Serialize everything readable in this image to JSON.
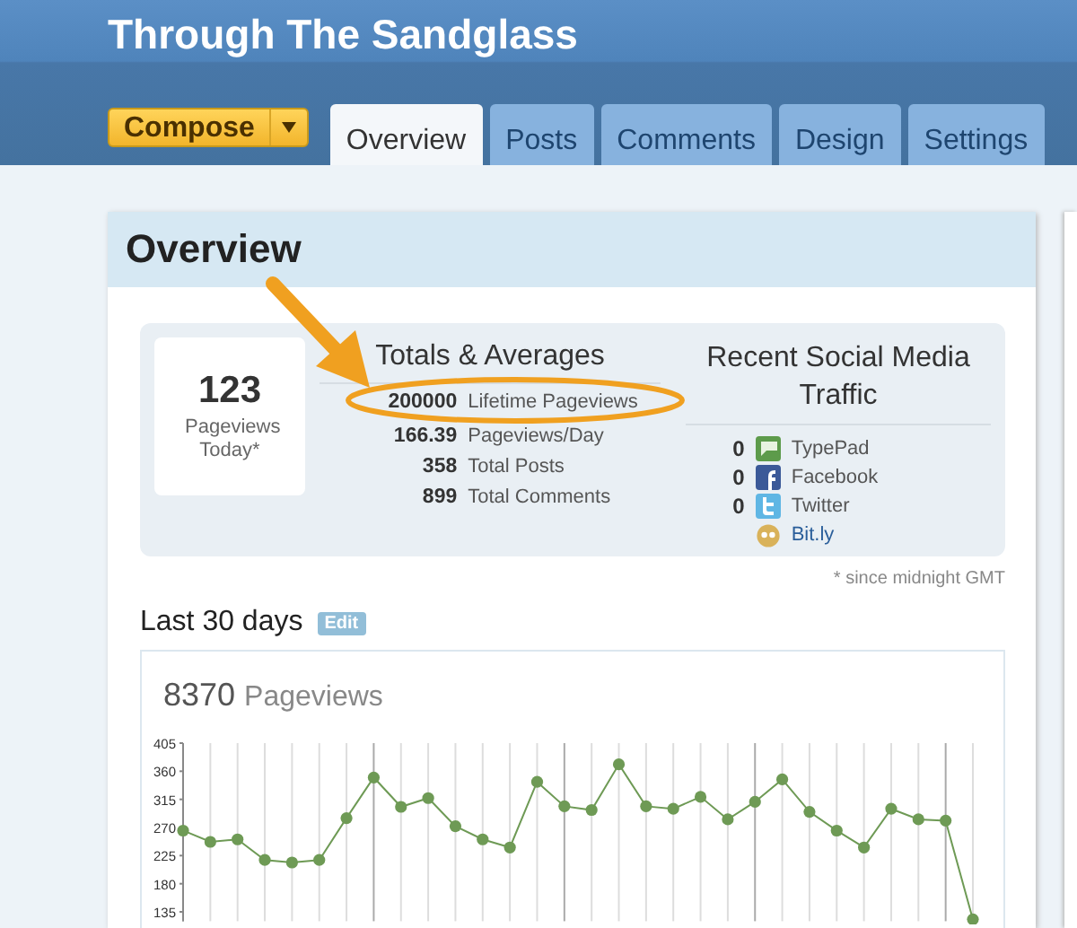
{
  "header": {
    "title": "Through The Sandglass"
  },
  "compose": {
    "label": "Compose"
  },
  "tabs": [
    {
      "label": "Overview",
      "selected": true
    },
    {
      "label": "Posts",
      "selected": false
    },
    {
      "label": "Comments",
      "selected": false
    },
    {
      "label": "Design",
      "selected": false
    },
    {
      "label": "Settings",
      "selected": false
    }
  ],
  "page_title": "Overview",
  "today": {
    "value": "123",
    "label": "Pageviews Today*"
  },
  "totals": {
    "title": "Totals & Averages",
    "rows": [
      {
        "number": "200000",
        "name": "Lifetime Pageviews",
        "highlighted": true
      },
      {
        "number": "166.39",
        "name": "Pageviews/Day",
        "highlighted": false
      },
      {
        "number": "358",
        "name": "Total Posts",
        "highlighted": false
      },
      {
        "number": "899",
        "name": "Total Comments",
        "highlighted": false
      }
    ]
  },
  "social": {
    "title": "Recent Social Media Traffic",
    "rows": [
      {
        "count": "0",
        "label": "TypePad",
        "kind": "typepad"
      },
      {
        "count": "0",
        "label": "Facebook",
        "kind": "facebook"
      },
      {
        "count": "0",
        "label": "Twitter",
        "kind": "twitter"
      },
      {
        "label": "Bit.ly",
        "kind": "bitly"
      }
    ]
  },
  "footnote": "* since midnight GMT",
  "last30": {
    "title": "Last 30 days",
    "edit": "Edit"
  },
  "chart": {
    "total": "8370",
    "unit": "Pageviews",
    "chart_data": {
      "type": "line",
      "grid": true,
      "series": [
        {
          "color": "#6e9a55",
          "marker": "circle",
          "values": [
            265,
            247,
            251,
            218,
            214,
            218,
            285,
            350,
            303,
            317,
            272,
            251,
            238,
            343,
            304,
            298,
            371,
            304,
            300,
            319,
            283,
            311,
            347,
            295,
            265,
            238,
            300,
            283,
            281,
            123
          ]
        }
      ],
      "ylim": [
        120,
        405
      ],
      "yticks": [
        135,
        180,
        225,
        270,
        315,
        360,
        405
      ]
    }
  }
}
